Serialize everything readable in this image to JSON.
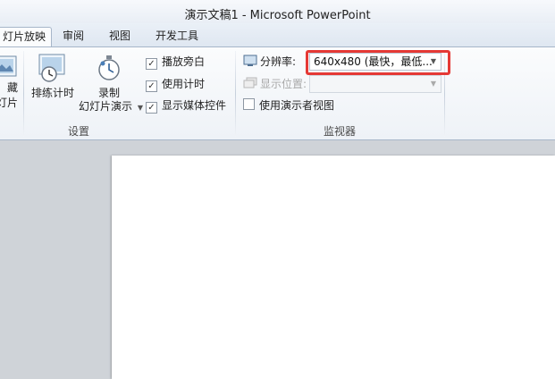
{
  "window": {
    "title": "演示文稿1 - Microsoft PowerPoint"
  },
  "tabs": [
    {
      "label": "灯片放映"
    },
    {
      "label": "审阅"
    },
    {
      "label": "视图"
    },
    {
      "label": "开发工具"
    }
  ],
  "setup_group": {
    "label": "设置",
    "hide_slide_line1": "藏",
    "hide_slide_line2": "灯片",
    "rehearse_label": "排练计时",
    "record_label": "录制",
    "record_sub_label": "幻灯片演示",
    "checkboxes": [
      {
        "label": "播放旁白",
        "checked": true
      },
      {
        "label": "使用计时",
        "checked": true
      },
      {
        "label": "显示媒体控件",
        "checked": true
      }
    ]
  },
  "monitor_group": {
    "label": "监视器",
    "resolution_label": "分辨率:",
    "resolution_value": "640x480 (最快，最低...",
    "show_on_label": "显示位置:",
    "show_on_value": "",
    "presenter_view_label": "使用演示者视图",
    "presenter_view_checked": false
  },
  "colors": {
    "highlight": "#e53935"
  }
}
